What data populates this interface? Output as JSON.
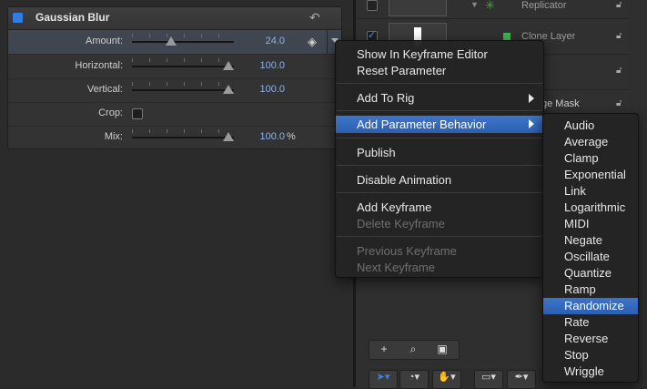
{
  "inspector": {
    "filter_title": "Gaussian Blur",
    "rows": [
      {
        "label": "Amount:",
        "value": "24.0",
        "level": 0.24
      },
      {
        "label": "Horizontal:",
        "value": "100.0",
        "level": 1.0
      },
      {
        "label": "Vertical:",
        "value": "100.0",
        "level": 1.0
      },
      {
        "label": "Crop:"
      },
      {
        "label": "Mix:",
        "value": "100.0",
        "unit": "%",
        "level": 1.0
      }
    ]
  },
  "layers": {
    "rows": [
      {
        "name": "Replicator"
      },
      {
        "name": "Clone Layer"
      },
      {
        "name": ""
      },
      {
        "name": "ge Mask"
      }
    ]
  },
  "context_menu": {
    "items": [
      {
        "label": "Show In Keyframe Editor",
        "enabled": true
      },
      {
        "label": "Reset Parameter",
        "enabled": true
      },
      {
        "label": "Add To Rig",
        "enabled": true,
        "submenu": true
      },
      {
        "label": "Add Parameter Behavior",
        "enabled": true,
        "submenu": true,
        "highlighted": true
      },
      {
        "label": "Publish",
        "enabled": true
      },
      {
        "label": "Disable Animation",
        "enabled": true
      },
      {
        "label": "Add Keyframe",
        "enabled": true
      },
      {
        "label": "Delete Keyframe",
        "enabled": false
      },
      {
        "label": "Previous Keyframe",
        "enabled": false
      },
      {
        "label": "Next Keyframe",
        "enabled": false
      }
    ]
  },
  "behavior_submenu": {
    "items": [
      "Audio",
      "Average",
      "Clamp",
      "Exponential",
      "Link",
      "Logarithmic",
      "MIDI",
      "Negate",
      "Oscillate",
      "Quantize",
      "Ramp",
      "Randomize",
      "Rate",
      "Reverse",
      "Stop",
      "Wriggle"
    ],
    "highlighted": "Randomize"
  },
  "colors": {
    "accent": "#2e66bf",
    "value_text": "#8fb4e6"
  }
}
